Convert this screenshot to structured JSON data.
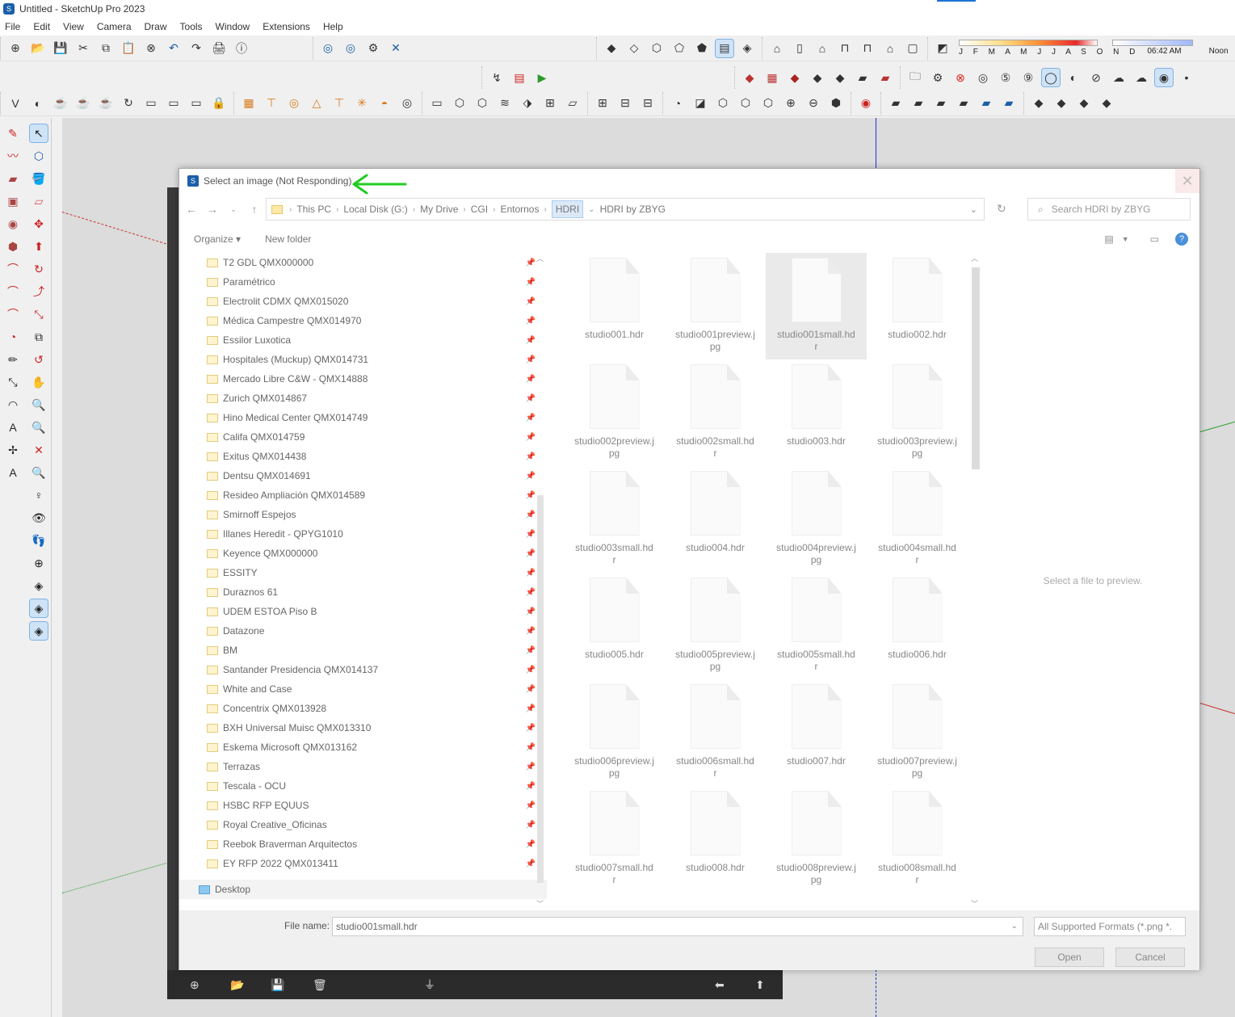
{
  "window": {
    "title": "Untitled - SketchUp Pro 2023",
    "menu": [
      "File",
      "Edit",
      "View",
      "Camera",
      "Draw",
      "Tools",
      "Window",
      "Extensions",
      "Help"
    ]
  },
  "shadow": {
    "months": "J F M A M J J A S O N D",
    "time": "06:42 AM",
    "noon": "Noon"
  },
  "dialog": {
    "title": "Select an image (Not Responding)",
    "breadcrumb": [
      "This PC",
      "Local Disk (G:)",
      "My Drive",
      "CGI",
      "Entornos",
      "HDRI",
      "HDRI by ZBYG"
    ],
    "search_placeholder": "Search HDRI by ZBYG",
    "organize": "Organize ▾",
    "new_folder": "New folder",
    "nav_items": [
      "T2 GDL QMX000000",
      "Paramétrico",
      "Electrolit CDMX QMX015020",
      "Médica Campestre QMX014970",
      "Essilor Luxotica",
      "Hospitales (Muckup) QMX014731",
      "Mercado Libre   C&W - QMX14888",
      "Zurich QMX014867",
      "Hino Medical Center QMX014749",
      "Califa QMX014759",
      "Exitus QMX014438",
      "Dentsu QMX014691",
      "Resideo Ampliación QMX014589",
      "Smirnoff Espejos",
      "Illanes Heredit - QPYG1010",
      "Keyence QMX000000",
      "ESSITY",
      "Duraznos 61",
      "UDEM ESTOA Piso B",
      "Datazone",
      "BM",
      "Santander Presidencia QMX014137",
      "White and Case",
      "Concentrix QMX013928",
      "BXH Universal Muisc QMX013310",
      "Eskema Microsoft QMX013162",
      "Terrazas",
      "Tescala - OCU",
      "HSBC RFP EQUUS",
      "Royal Creative_Oficinas",
      "Reebok   Braverman Arquitectos",
      "EY RFP 2022 QMX013411"
    ],
    "desktop": "Desktop",
    "files": [
      "studio001.hdr",
      "studio001preview.jpg",
      "studio001small.hdr",
      "studio002.hdr",
      "studio002preview.jpg",
      "studio002small.hdr",
      "studio003.hdr",
      "studio003preview.jpg",
      "studio003small.hdr",
      "studio004.hdr",
      "studio004preview.jpg",
      "studio004small.hdr",
      "studio005.hdr",
      "studio005preview.jpg",
      "studio005small.hdr",
      "studio006.hdr",
      "studio006preview.jpg",
      "studio006small.hdr",
      "studio007.hdr",
      "studio007preview.jpg",
      "studio007small.hdr",
      "studio008.hdr",
      "studio008preview.jpg",
      "studio008small.hdr"
    ],
    "selected_file_index": 2,
    "preview_text": "Select a file to preview.",
    "file_name_label": "File name:",
    "file_name_value": "studio001small.hdr",
    "filter": "All Supported Formats (*.png *.",
    "open": "Open",
    "cancel": "Cancel"
  },
  "colors": {
    "accent": "#1e73d6",
    "green_arrow": "#22cc22",
    "axis_red": "#cc3333",
    "axis_blue": "#1e2fd6"
  }
}
